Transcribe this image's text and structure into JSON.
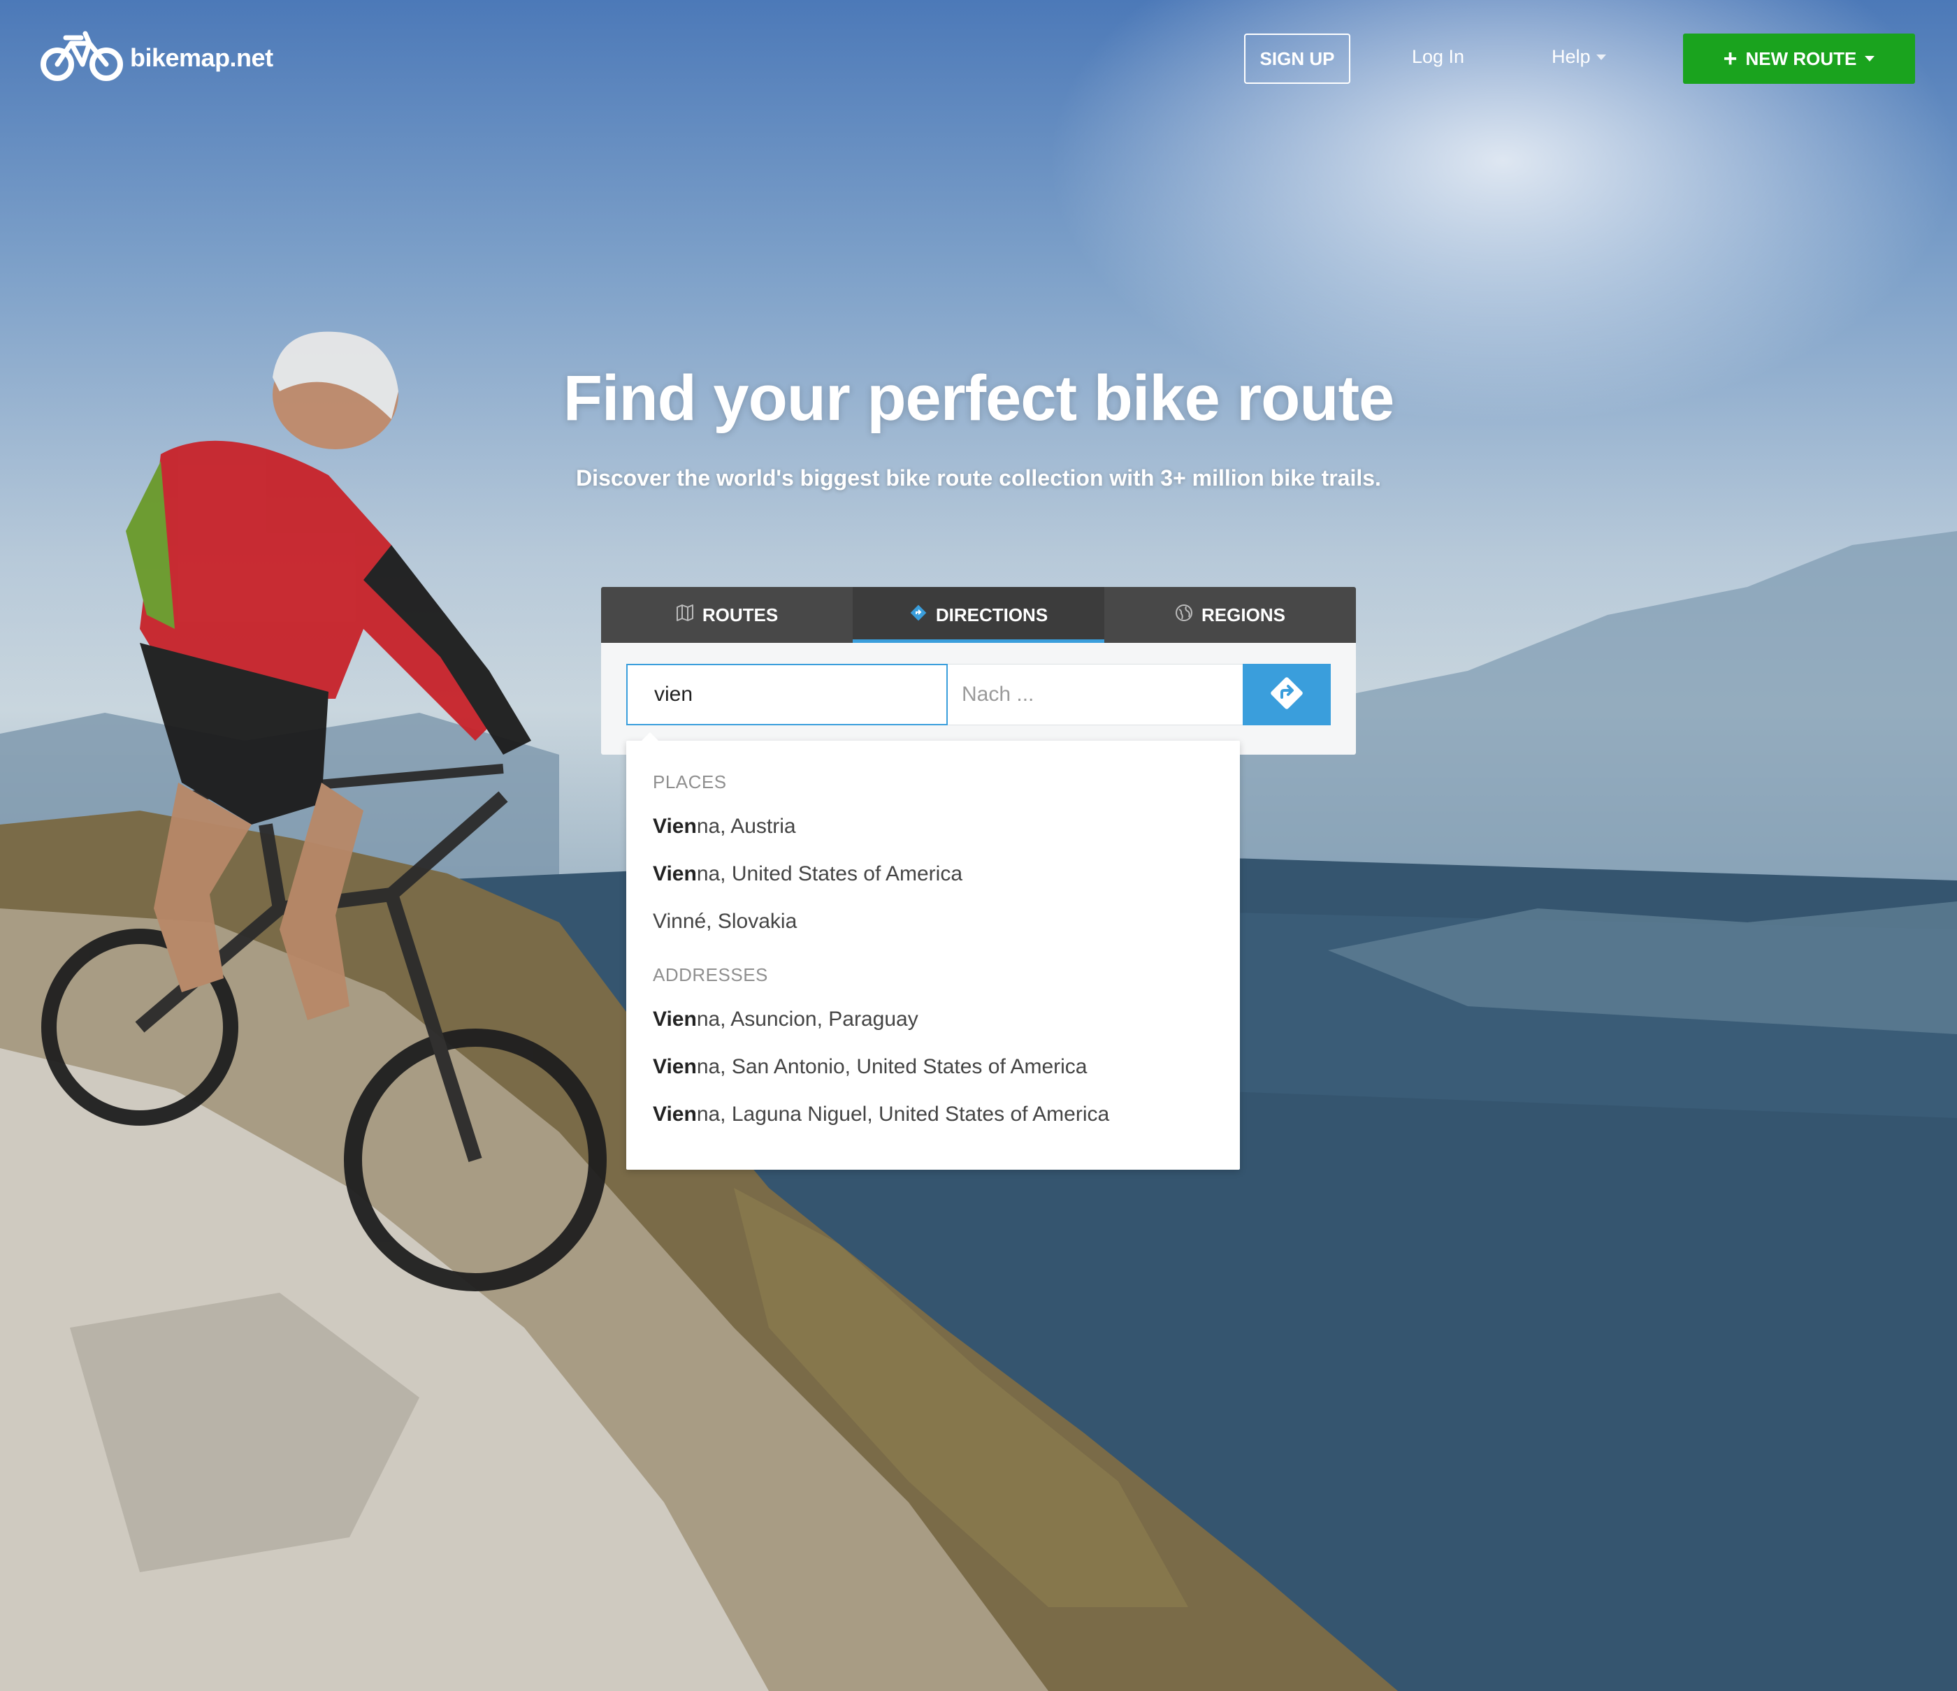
{
  "header": {
    "logo_text": "bikemap.net",
    "signup_label": "SIGN UP",
    "login_label": "Log In",
    "help_label": "Help",
    "new_route_label": "NEW ROUTE"
  },
  "hero": {
    "title": "Find your perfect bike route",
    "subtitle": "Discover the world's biggest bike route collection with 3+ million bike trails."
  },
  "search": {
    "tabs": [
      {
        "label": "ROUTES",
        "icon": "map-icon"
      },
      {
        "label": "DIRECTIONS",
        "icon": "directions-icon",
        "active": true
      },
      {
        "label": "REGIONS",
        "icon": "globe-icon"
      }
    ],
    "from_value": "vien",
    "to_placeholder": "Nach ...",
    "go_icon": "turn-right-arrow-icon"
  },
  "suggestions": {
    "places_label": "PLACES",
    "places": [
      {
        "match": "Vien",
        "rest": "na, Austria"
      },
      {
        "match": "Vien",
        "rest": "na, United States of America"
      },
      {
        "match": "",
        "rest": "Vinné, Slovakia"
      }
    ],
    "addresses_label": "ADDRESSES",
    "addresses": [
      {
        "match": "Vien",
        "rest": "na, Asuncion, Paraguay"
      },
      {
        "match": "Vien",
        "rest": "na, San Antonio, United States of America"
      },
      {
        "match": "Vien",
        "rest": "na, Laguna Niguel, United States of America"
      }
    ]
  },
  "colors": {
    "accent_blue": "#3a9edc",
    "new_route_green": "#1aa31e",
    "tab_bar": "#484848"
  }
}
